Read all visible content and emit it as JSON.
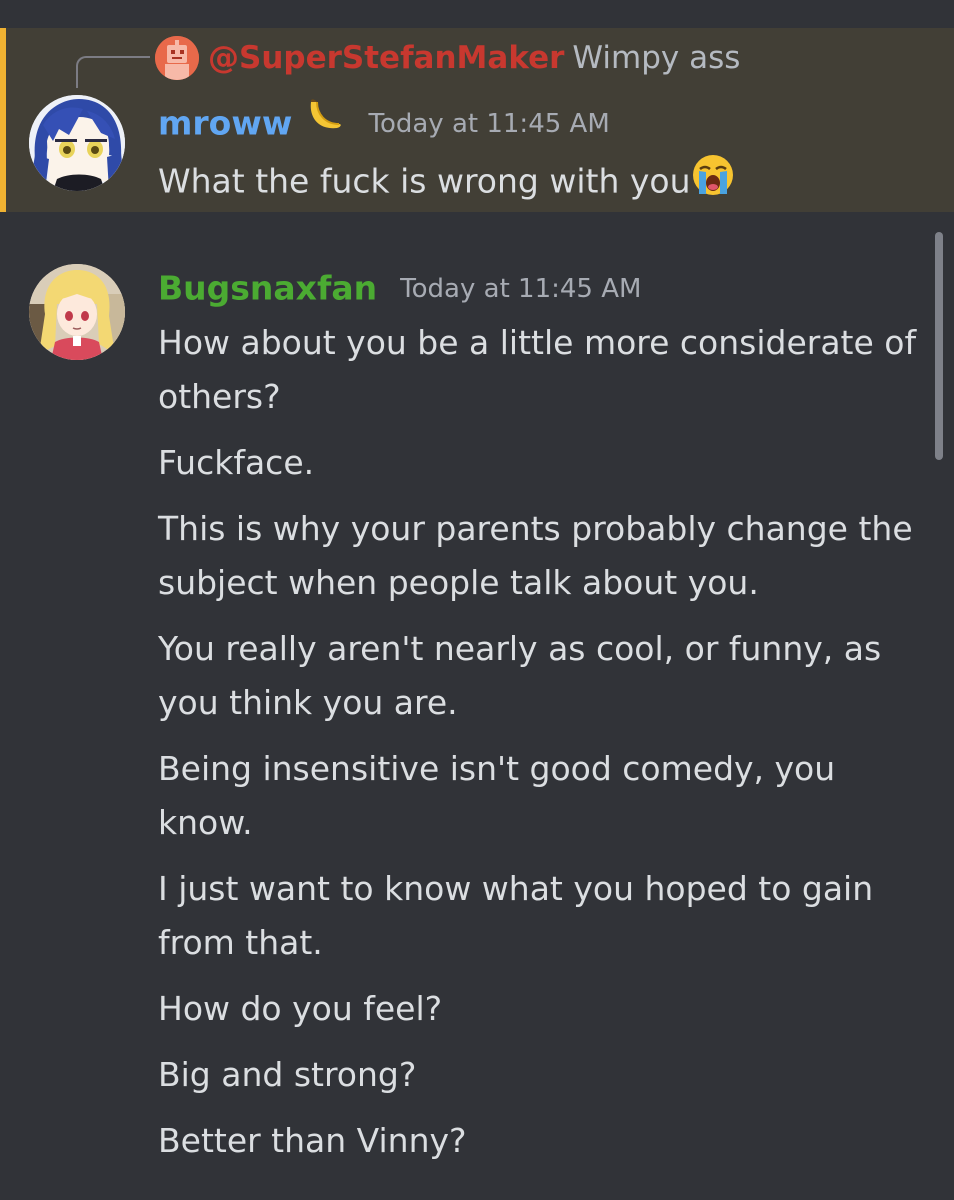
{
  "reply": {
    "username": "@SuperStefanMaker",
    "text": "Wimpy ass"
  },
  "messages": [
    {
      "username": "mroww",
      "username_color": "#61a6f2",
      "badge_icon": "banana-icon",
      "timestamp": "Today at 11:45 AM",
      "text": "What the fuck is wrong with you",
      "emoji": "loudly-crying-face-icon"
    },
    {
      "username": "Bugsnaxfan",
      "username_color": "#4bab32",
      "timestamp": "Today at 11:45 AM",
      "lines": [
        "How about you be a little more considerate of others?",
        "Fuckface.",
        "This is why your parents probably change the subject when people talk about you.",
        "You really aren't nearly as cool, or funny, as you think you are.",
        "Being insensitive isn't good comedy, you know.",
        "I just want to know what you hoped to gain from that.",
        "How do you feel?",
        "Big and strong?",
        "Better than Vinny?"
      ]
    }
  ],
  "colors": {
    "background": "#313338",
    "mention_highlight": "#423f36",
    "mention_bar": "#f0b232",
    "reply_username": "#c8382f"
  }
}
